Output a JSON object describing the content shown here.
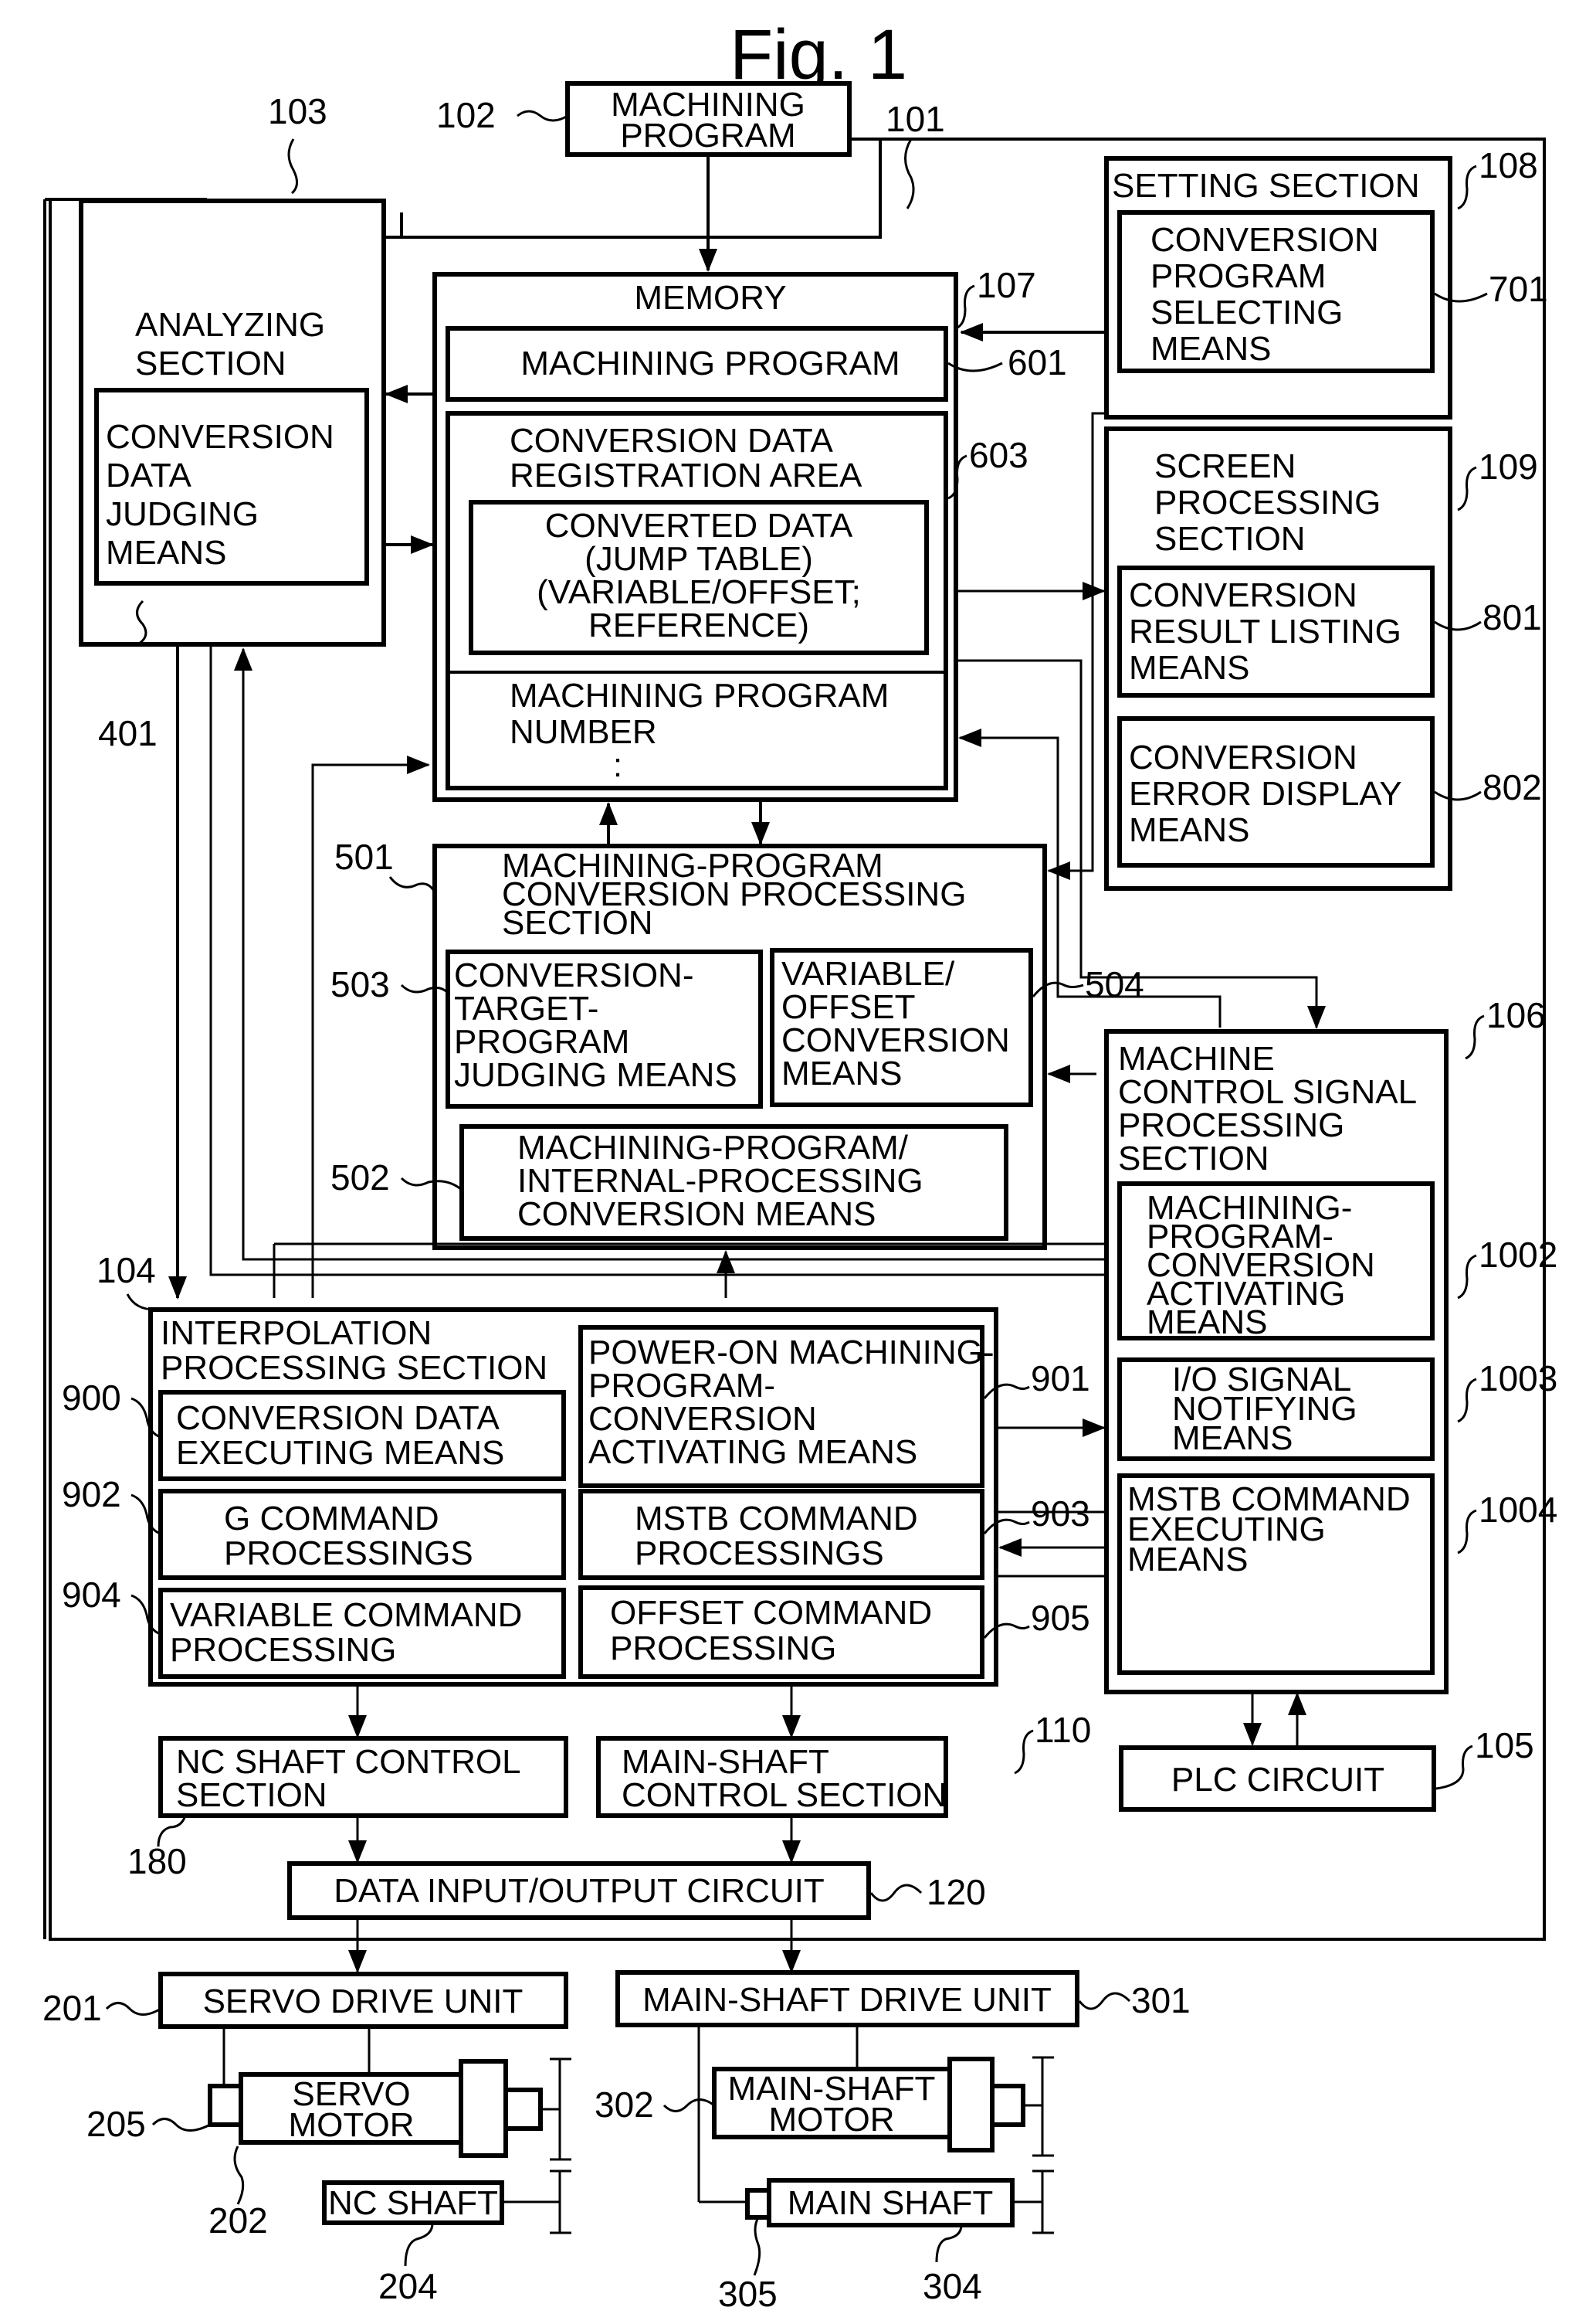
{
  "figure": {
    "title": "Fig. 1"
  },
  "blocks": {
    "machining_program": {
      "ref": "102",
      "lines": [
        "MACHINING",
        "PROGRAM"
      ]
    },
    "nc_device": {
      "ref": "101"
    },
    "analyzing": {
      "ref": "103",
      "lines": [
        "ANALYZING",
        "SECTION"
      ]
    },
    "conversion_data_judging": {
      "ref": "401",
      "lines": [
        "CONVERSION",
        "DATA",
        "JUDGING",
        "MEANS"
      ]
    },
    "memory": {
      "ref": "107",
      "title": "MEMORY"
    },
    "memory_machining_program": {
      "ref": "601",
      "lines": [
        "MACHINING PROGRAM"
      ]
    },
    "conversion_data_registration": {
      "ref": "603",
      "lines": [
        "CONVERSION DATA",
        "REGISTRATION AREA"
      ]
    },
    "converted_data": {
      "lines": [
        "CONVERTED DATA",
        "(JUMP TABLE)",
        "(VARIABLE/OFFSET;",
        "REFERENCE)"
      ]
    },
    "machining_program_number": {
      "lines": [
        "MACHINING PROGRAM",
        "NUMBER",
        ":"
      ]
    },
    "setting": {
      "ref": "108",
      "title": "SETTING SECTION"
    },
    "conversion_program_selecting": {
      "ref": "701",
      "lines": [
        "CONVERSION",
        "PROGRAM",
        "SELECTING",
        "MEANS"
      ]
    },
    "screen_processing": {
      "ref": "109",
      "lines": [
        "SCREEN",
        "PROCESSING",
        "SECTION"
      ]
    },
    "conversion_result_listing": {
      "ref": "801",
      "lines": [
        "CONVERSION",
        "RESULT LISTING",
        "MEANS"
      ]
    },
    "conversion_error_display": {
      "ref": "802",
      "lines": [
        "CONVERSION",
        "ERROR DISPLAY",
        "MEANS"
      ]
    },
    "mp_conversion_processing": {
      "ref": "501",
      "lines": [
        "MACHINING-PROGRAM",
        "CONVERSION PROCESSING",
        "SECTION"
      ]
    },
    "conversion_target_judging": {
      "ref": "503",
      "lines": [
        "CONVERSION-",
        "TARGET-",
        "PROGRAM",
        "JUDGING MEANS"
      ]
    },
    "variable_offset_conversion": {
      "ref": "504",
      "lines": [
        "VARIABLE/",
        "OFFSET",
        "CONVERSION",
        "MEANS"
      ]
    },
    "mp_internal_conversion": {
      "ref": "502",
      "lines": [
        "MACHINING-PROGRAM/",
        "INTERNAL-PROCESSING",
        "CONVERSION MEANS"
      ]
    },
    "machine_control_signal": {
      "ref": "106",
      "lines": [
        "MACHINE",
        "CONTROL SIGNAL",
        "PROCESSING",
        "SECTION"
      ]
    },
    "mp_conversion_activating": {
      "ref": "1002",
      "lines": [
        "MACHINING-",
        "PROGRAM-",
        "CONVERSION",
        "ACTIVATING",
        "MEANS"
      ]
    },
    "io_signal_notifying": {
      "ref": "1003",
      "lines": [
        "I/O SIGNAL",
        "NOTIFYING",
        "MEANS"
      ]
    },
    "mstb_command_executing": {
      "ref": "1004",
      "lines": [
        "MSTB COMMAND",
        "EXECUTING",
        "MEANS"
      ]
    },
    "interpolation": {
      "ref": "104",
      "lines": [
        "INTERPOLATION",
        "PROCESSING SECTION"
      ]
    },
    "conversion_data_executing": {
      "ref": "900",
      "lines": [
        "CONVERSION DATA",
        "EXECUTING MEANS"
      ]
    },
    "power_on_activating": {
      "ref": "901",
      "lines": [
        "POWER-ON MACHINING-",
        "PROGRAM-",
        "CONVERSION",
        "ACTIVATING MEANS"
      ]
    },
    "g_command": {
      "ref": "902",
      "lines": [
        "G COMMAND",
        "PROCESSINGS"
      ]
    },
    "mstb_command_processings": {
      "ref": "903",
      "lines": [
        "MSTB COMMAND",
        "PROCESSINGS"
      ]
    },
    "variable_command": {
      "ref": "904",
      "lines": [
        "VARIABLE COMMAND",
        "PROCESSING"
      ]
    },
    "offset_command": {
      "ref": "905",
      "lines": [
        "OFFSET COMMAND",
        "PROCESSING"
      ]
    },
    "nc_shaft_control": {
      "ref": "180",
      "lines": [
        "NC SHAFT CONTROL",
        "SECTION"
      ]
    },
    "main_shaft_control": {
      "ref": "110",
      "lines": [
        "MAIN-SHAFT",
        "CONTROL SECTION"
      ]
    },
    "plc_circuit": {
      "ref": "105",
      "lines": [
        "PLC CIRCUIT"
      ]
    },
    "data_io_circuit": {
      "ref": "120",
      "lines": [
        "DATA INPUT/OUTPUT CIRCUIT"
      ]
    },
    "servo_drive_unit": {
      "ref": "201",
      "lines": [
        "SERVO DRIVE UNIT"
      ]
    },
    "main_shaft_drive_unit": {
      "ref": "301",
      "lines": [
        "MAIN-SHAFT DRIVE UNIT"
      ]
    },
    "servo_motor": {
      "ref": "202",
      "lines": [
        "SERVO",
        "MOTOR"
      ]
    },
    "servo_encoder": {
      "ref": "205"
    },
    "nc_shaft": {
      "ref": "204",
      "lines": [
        "NC SHAFT"
      ]
    },
    "main_shaft_motor": {
      "ref": "302",
      "lines": [
        "MAIN-SHAFT",
        "MOTOR"
      ]
    },
    "main_shaft": {
      "ref": "304",
      "lines": [
        "MAIN SHAFT"
      ]
    },
    "main_shaft_encoder": {
      "ref": "305"
    }
  }
}
